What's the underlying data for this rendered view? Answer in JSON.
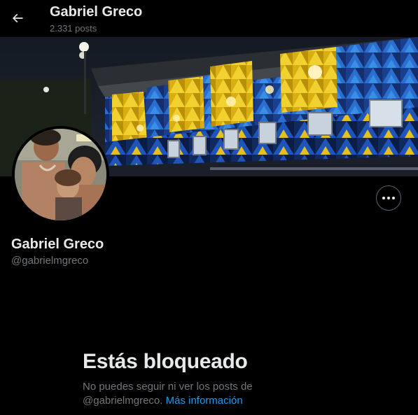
{
  "header": {
    "title": "Gabriel Greco",
    "posts_count": "2.331 posts"
  },
  "profile": {
    "name": "Gabriel Greco",
    "handle": "@gabrielmgreco"
  },
  "blocked": {
    "title": "Estás bloqueado",
    "message_line1": "No puedes seguir ni ver los posts de",
    "message_handle": "@gabrielmgreco.",
    "link_label": "Más información"
  },
  "colors": {
    "background": "#000000",
    "primary_text": "#e7e9ea",
    "secondary_text": "#71767b",
    "link": "#1d9bf0",
    "banner_blue": "#1c4fa8",
    "banner_yellow": "#e8c21c"
  },
  "icons": {
    "back": "arrow-left-icon",
    "more": "more-horizontal-icon"
  }
}
